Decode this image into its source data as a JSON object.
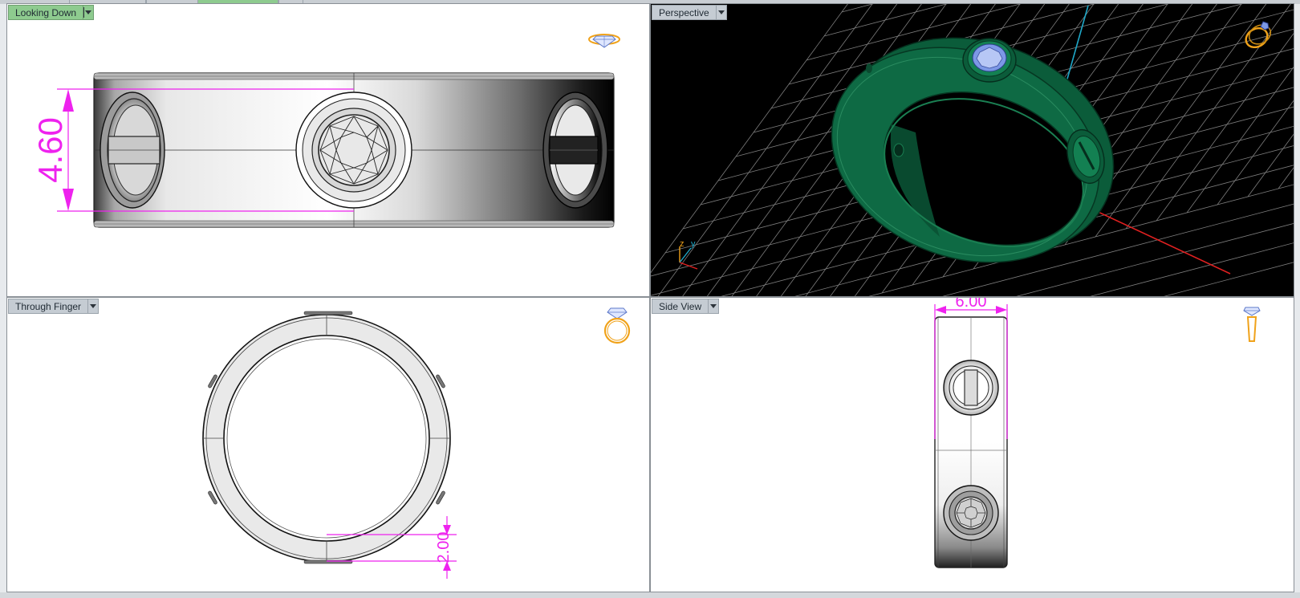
{
  "viewports": {
    "top_left": {
      "title": "Looking Down",
      "active": true,
      "dimension": "4.60"
    },
    "top_right": {
      "title": "Perspective",
      "axis_labels": {
        "z": "z",
        "y": "y"
      }
    },
    "bottom_left": {
      "title": "Through Finger",
      "dimension": "2.00"
    },
    "bottom_right": {
      "title": "Side View",
      "dimension": "6.00"
    }
  },
  "icons": {
    "top_left": "ring-top-view-icon",
    "top_right": "ring-perspective-icon",
    "bottom_left": "ring-front-view-icon",
    "bottom_right": "ring-side-view-icon"
  },
  "colors": {
    "dimension": "#ee22ee",
    "ring_green": "#0e6a44",
    "gem_blue": "#7c98e6",
    "icon_orange": "#f0a21a",
    "axis_red": "#e02020",
    "axis_cyan": "#1fa8c8",
    "grid": "#8a8a8a",
    "active_tab": "#8ecb8f"
  }
}
